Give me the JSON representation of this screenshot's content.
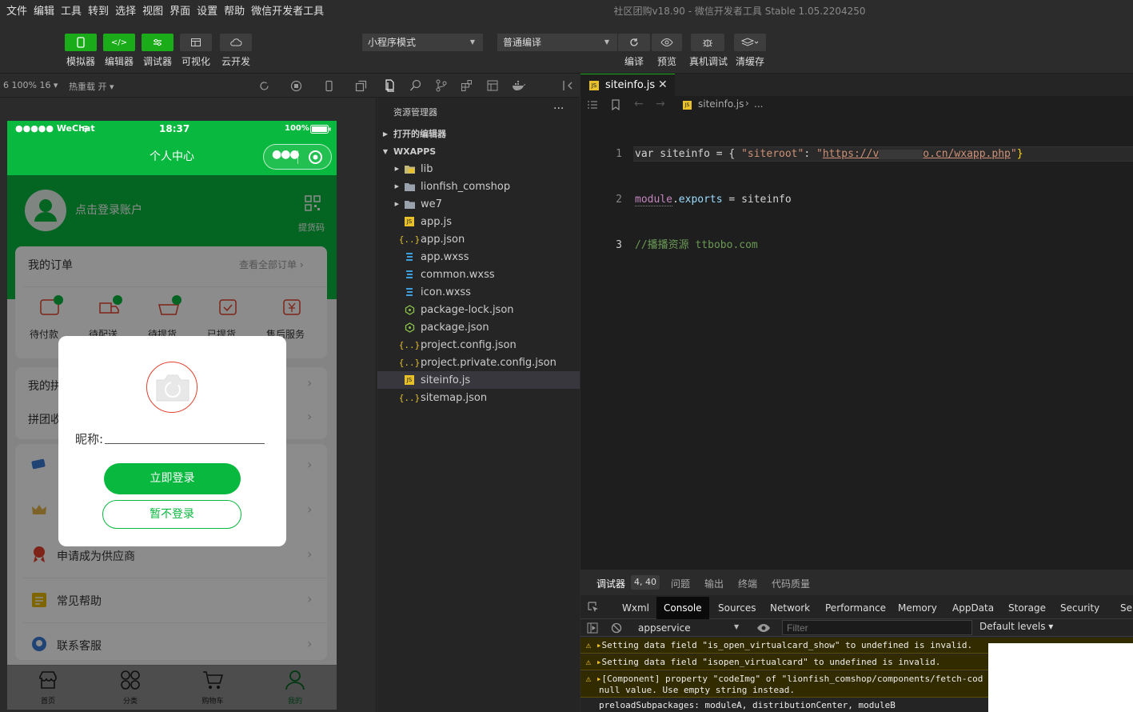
{
  "menu": [
    "文件",
    "编辑",
    "工具",
    "转到",
    "选择",
    "视图",
    "界面",
    "设置",
    "帮助",
    "微信开发者工具"
  ],
  "window_title": "社区团购v18.90 - 微信开发者工具 Stable 1.05.2204250",
  "toolbar": {
    "simulator": "模拟器",
    "editor": "编辑器",
    "debugger": "调试器",
    "visual": "可视化",
    "cloud": "云开发",
    "mode_select": "小程序模式",
    "compile_select": "普通编译",
    "compile": "编译",
    "preview": "预览",
    "real_debug": "真机调试",
    "clear_cache": "清缓存"
  },
  "subbar": {
    "device": "6 100% 16",
    "hot_reload": "热重载 开"
  },
  "phone": {
    "status_carrier": "●●●●● WeChat",
    "status_time": "18:37",
    "status_battery": "100%",
    "nav_title": "个人中心",
    "login_prompt": "点击登录账户",
    "pickup_code": "提货码",
    "orders_title": "我的订单",
    "orders_all": "查看全部订单",
    "order_items": [
      "待付款",
      "待配送",
      "待提货",
      "已提货",
      "售后服务"
    ],
    "menu_rows": [
      "我的拼",
      "拼团收",
      "申请成为供应商",
      "常见帮助",
      "联系客服"
    ],
    "tabbar": [
      "首页",
      "分类",
      "购物车",
      "我的"
    ]
  },
  "modal": {
    "nickname_label": "昵称:",
    "login_button": "立即登录",
    "skip_button": "暂不登录"
  },
  "explorer": {
    "title": "资源管理器",
    "more": "···",
    "open_editors": "打开的编辑器",
    "root": "WXAPPS",
    "items": [
      {
        "name": "lib",
        "kind": "folder-lib"
      },
      {
        "name": "lionfish_comshop",
        "kind": "folder"
      },
      {
        "name": "we7",
        "kind": "folder"
      },
      {
        "name": "app.js",
        "kind": "js"
      },
      {
        "name": "app.json",
        "kind": "json"
      },
      {
        "name": "app.wxss",
        "kind": "wxss"
      },
      {
        "name": "common.wxss",
        "kind": "wxss"
      },
      {
        "name": "icon.wxss",
        "kind": "wxss"
      },
      {
        "name": "package-lock.json",
        "kind": "npm"
      },
      {
        "name": "package.json",
        "kind": "npm"
      },
      {
        "name": "project.config.json",
        "kind": "json"
      },
      {
        "name": "project.private.config.json",
        "kind": "json"
      },
      {
        "name": "siteinfo.js",
        "kind": "js"
      },
      {
        "name": "sitemap.json",
        "kind": "json"
      }
    ],
    "selected": "siteinfo.js"
  },
  "editor": {
    "tab": "siteinfo.js",
    "breadcrumb": "siteinfo.js",
    "breadcrumb_tail": "...",
    "line_numbers": [
      "1",
      "2",
      "3"
    ],
    "line1": {
      "a": "var siteinfo = { ",
      "b": "\"siteroot\"",
      "c": ": ",
      "d": "\"",
      "e": "https://v",
      "f": "o.cn/wxapp.php",
      "g": "\"",
      "h": "}"
    },
    "line2": {
      "a": "module",
      "b": ".",
      "c": "exports",
      "d": " = siteinfo"
    },
    "line3": "//播播资源 ttbobo.com"
  },
  "console": {
    "tabs_top": [
      "调试器",
      "问题",
      "输出",
      "终端",
      "代码质量"
    ],
    "badge": "4, 40",
    "tabs": [
      "Wxml",
      "Console",
      "Sources",
      "Network",
      "Performance",
      "Memory",
      "AppData",
      "Storage",
      "Security",
      "Ser"
    ],
    "active_tab": "Console",
    "context": "appservice",
    "filter_placeholder": "Filter",
    "levels": "Default levels",
    "messages": [
      "Setting data field \"is_open_virtualcard_show\" to undefined is invalid.",
      "Setting data field \"isopen_virtualcard\" to undefined is invalid.",
      "[Component] property \"codeImg\" of \"lionfish_comshop/components/fetch-cod",
      "null value. Use empty string instead."
    ],
    "preload": "preloadSubpackages: moduleA, distributionCenter, moduleB"
  },
  "colors": {
    "accent_green": "#09b83e",
    "toolbar_green": "#1aad19",
    "js_yellow": "#e8c02a",
    "wxss_blue": "#3d9ddd",
    "npm_green": "#8bc34a"
  }
}
